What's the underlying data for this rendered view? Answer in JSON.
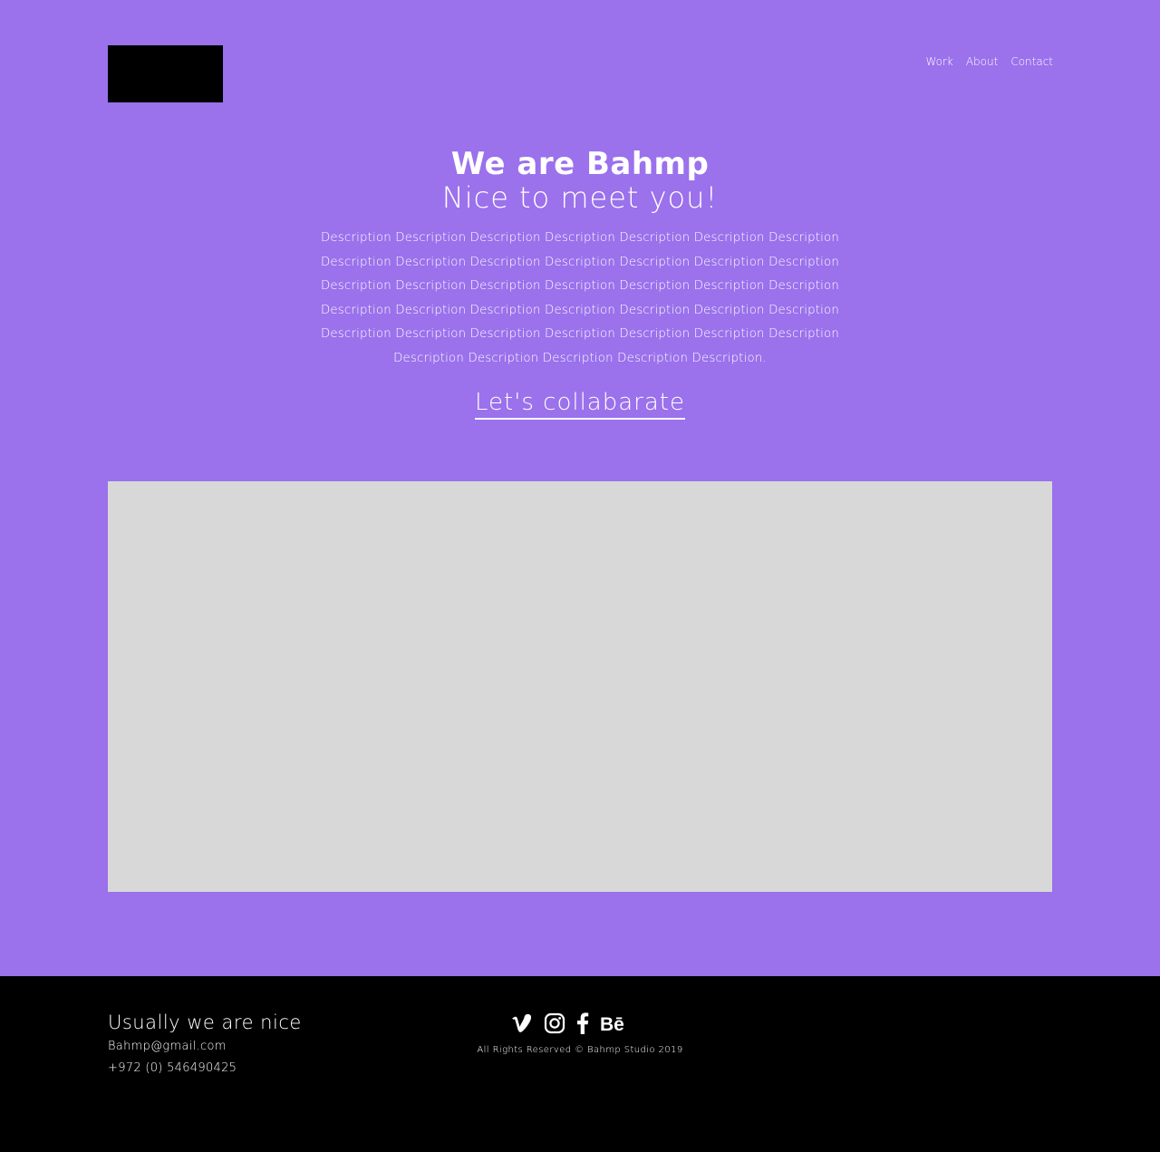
{
  "header": {
    "nav": [
      {
        "label": "Work"
      },
      {
        "label": "About"
      },
      {
        "label": "Contact"
      }
    ]
  },
  "hero": {
    "title": "We are Bahmp",
    "subtitle": "Nice to meet you!",
    "description": "Description Description Description Description Description Description Description Description Description Description Description Description Description Description Description Description Description Description Description Description Description Description Description Description Description Description Description Description Description Description Description Description Description Description Description Description Description Description Description Description.",
    "cta_label": "Let's collabarate"
  },
  "footer": {
    "tagline": "Usually we are nice",
    "email": "Bahmp@gmail.com",
    "phone": "+972 (0) 546490425",
    "copyright": "All Rights Reserved © Bahmp Studio 2019",
    "social_icons": [
      "vimeo-icon",
      "instagram-icon",
      "facebook-icon",
      "behance-icon"
    ]
  },
  "colors": {
    "background": "#9b71ec",
    "footer_background": "#000000",
    "media_placeholder": "#d8d8d8",
    "text": "#ffffff"
  }
}
